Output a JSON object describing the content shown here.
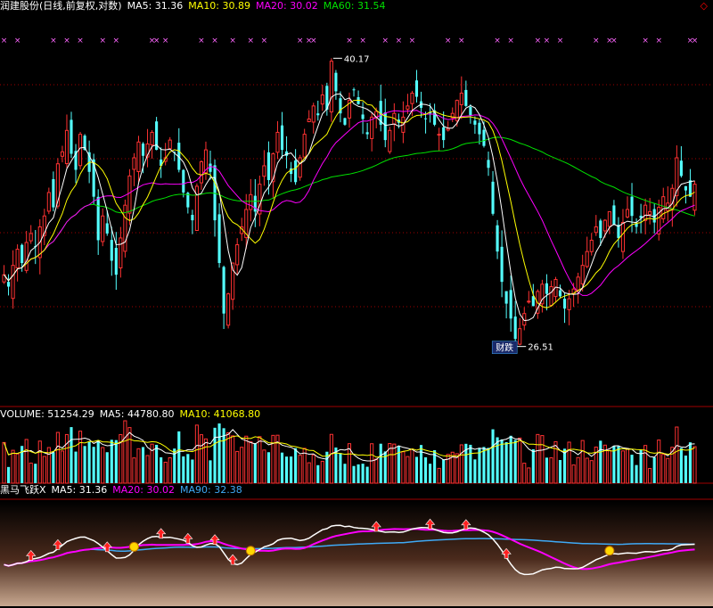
{
  "colors": {
    "up": "#ff3232",
    "down": "#54ffff",
    "ma5": "#ffffff",
    "ma10": "#ffff00",
    "ma20": "#ff00ff",
    "ma60": "#00e000",
    "ma90": "#3fa9f5",
    "grid": "#a00000",
    "text": "#ffffff"
  },
  "header": {
    "title": "润建股份(日线,前复权,对数)",
    "ma5": "MA5: 31.36",
    "ma10": "MA10: 30.89",
    "ma20": "MA20: 30.02",
    "ma60": "MA60: 31.54",
    "fav_icon": "diamond-icon"
  },
  "volume_header": {
    "title": "VOLUME: 51254.29",
    "ma5": "MA5: 44780.80",
    "ma10": "MA10: 41068.80"
  },
  "indicator_header": {
    "title": "黑马飞跃X",
    "ma5": "MA5: 31.36",
    "ma20": "MA20: 30.02",
    "ma90": "MA90: 32.38"
  },
  "annotations": {
    "high": "40.17",
    "low": "26.51",
    "badge": "财跌"
  },
  "chart_data": {
    "type": "candlestick",
    "price_range": [
      24.5,
      42.8
    ],
    "scale": "log",
    "bars": 155,
    "close": [
      29.4,
      28.9,
      29.8,
      30.5,
      29.9,
      30.8,
      31.2,
      30.6,
      31.5,
      32.0,
      33.1,
      32.4,
      34.5,
      35.1,
      36.2,
      35.0,
      34.2,
      36.0,
      35.2,
      34.1,
      32.9,
      30.9,
      32.0,
      31.2,
      30.0,
      29.4,
      31.0,
      32.5,
      33.9,
      34.8,
      35.6,
      34.9,
      35.5,
      36.1,
      35.2,
      34.4,
      34.8,
      35.7,
      35.1,
      34.2,
      33.1,
      32.4,
      31.8,
      33.4,
      34.6,
      35.2,
      34.1,
      31.8,
      29.9,
      27.8,
      28.6,
      29.9,
      30.7,
      31.5,
      32.3,
      33.0,
      32.2,
      33.5,
      34.4,
      33.7,
      35.0,
      36.1,
      35.2,
      34.9,
      34.0,
      33.6,
      34.8,
      36.0,
      36.8,
      37.5,
      37.0,
      38.1,
      37.3,
      40.0,
      38.3,
      37.1,
      36.5,
      37.8,
      38.4,
      37.6,
      36.8,
      36.0,
      36.9,
      37.2,
      36.5,
      35.7,
      36.2,
      37.1,
      36.6,
      36.9,
      37.5,
      38.2,
      38.0,
      37.4,
      36.8,
      37.1,
      36.5,
      36.0,
      35.7,
      36.3,
      37.1,
      37.8,
      38.2,
      37.5,
      37.0,
      36.5,
      36.0,
      35.4,
      34.3,
      32.1,
      30.4,
      29.1,
      28.2,
      27.6,
      26.8,
      27.2,
      27.8,
      28.3,
      28.1,
      28.7,
      29.0,
      28.6,
      28.9,
      29.2,
      28.5,
      28.0,
      28.4,
      28.8,
      29.3,
      29.8,
      30.4,
      30.9,
      31.5,
      31.0,
      31.8,
      32.2,
      31.6,
      31.0,
      31.7,
      32.3,
      32.0,
      31.5,
      31.9,
      32.5,
      32.2,
      31.7,
      32.4,
      32.9,
      32.6,
      33.3,
      34.8,
      33.9,
      33.2,
      32.9,
      33.5
    ],
    "high_label": 40.17,
    "low_label": 26.51,
    "series": [
      {
        "name": "MA5",
        "value": 31.36
      },
      {
        "name": "MA10",
        "value": 30.89
      },
      {
        "name": "MA20",
        "value": 30.02
      },
      {
        "name": "MA60",
        "value": 31.54
      }
    ],
    "volume": {
      "last": 51254.29,
      "ma5": 44780.8,
      "ma10": 41068.8
    },
    "indicator": {
      "name": "黑马飞跃X",
      "ma5": 31.36,
      "ma20": 30.02,
      "ma90": 32.38
    }
  }
}
